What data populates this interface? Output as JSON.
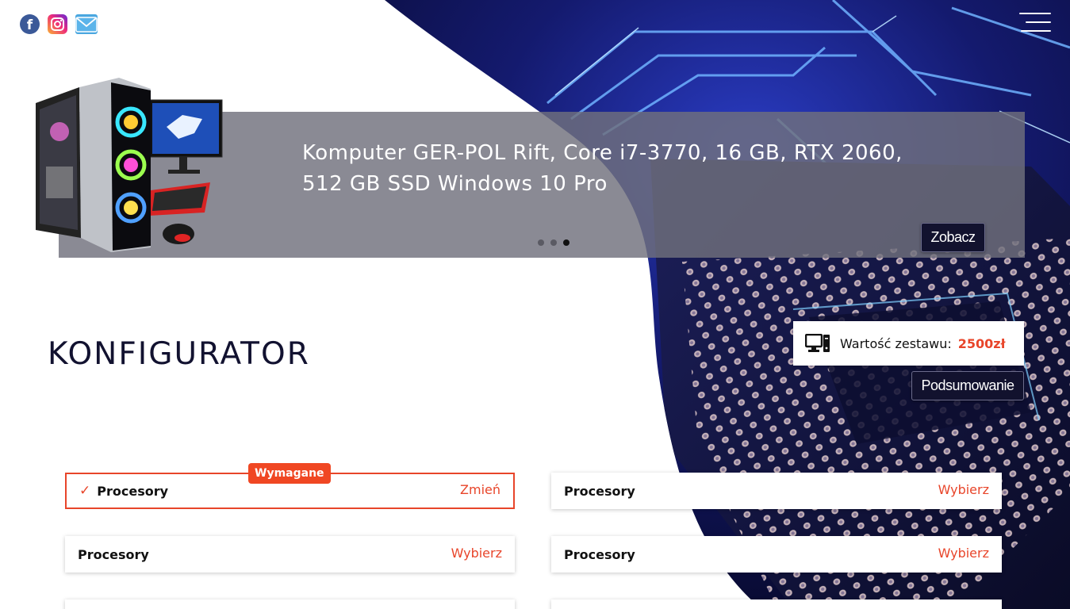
{
  "header": {
    "social": [
      {
        "name": "facebook-icon",
        "glyph": "f"
      },
      {
        "name": "instagram-icon"
      },
      {
        "name": "mail-icon"
      }
    ],
    "menu_icon": "hamburger-menu-icon"
  },
  "slider": {
    "title": "Komputer GER-POL Rift, Core i7-3770, 16 GB, RTX 2060, 512 GB SSD Windows 10 Pro",
    "button_label": "Zobacz",
    "dots": 3,
    "active_dot": 3
  },
  "configurator": {
    "title": "KONFIGURATOR",
    "value_label": "Wartość zestawu:",
    "value_amount": "2500zł",
    "summary_button": "Podsumowanie",
    "required_badge": "Wymagane",
    "cards": [
      {
        "label": "Procesory",
        "action": "Zmień",
        "selected": true
      },
      {
        "label": "Procesory",
        "action": "Wybierz",
        "selected": false
      },
      {
        "label": "Procesory",
        "action": "Wybierz",
        "selected": false
      },
      {
        "label": "Procesory",
        "action": "Wybierz",
        "selected": false
      }
    ]
  },
  "colors": {
    "accent": "#e8452a",
    "dark_button": "#12122e",
    "title": "#121230",
    "slider_overlay": "#70707d"
  }
}
